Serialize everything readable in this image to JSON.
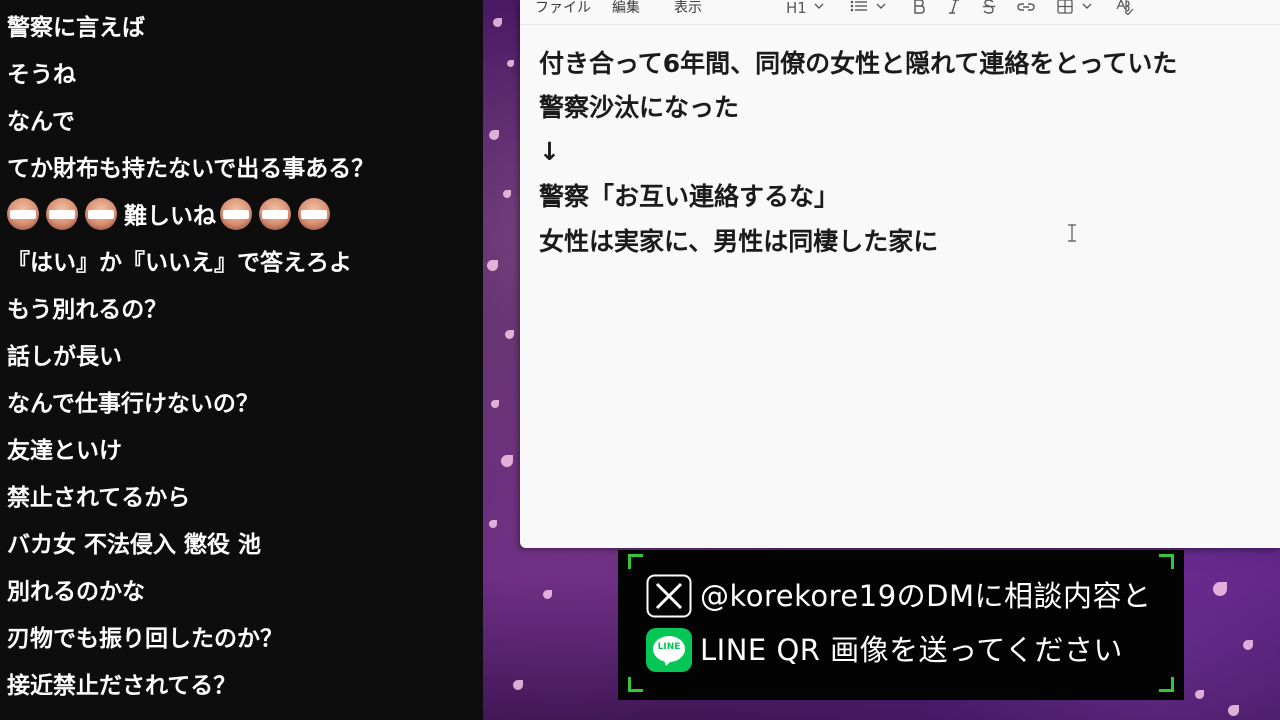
{
  "chat": {
    "messages": [
      "警察に言えば",
      "そうね",
      "なんで",
      "てか財布も持たないで出る事ある？",
      "難しいね",
      "『はい』か『いいえ』で答えろよ",
      "もう別れるの？",
      "話しが長い",
      "なんで仕事行けないの？",
      "友達といけ",
      "禁止されてるから",
      "バカ女 不法侵入 懲役 池",
      "別れるのかな",
      "刃物でも振り回したのか？",
      "接近禁止だされてる？"
    ]
  },
  "editor": {
    "menu": {
      "file": "ファイル",
      "edit": "編集",
      "view": "表示"
    },
    "toolbar": {
      "heading": "H1",
      "icons": [
        "heading-dropdown",
        "list-icon",
        "bold-icon",
        "italic-icon",
        "strikethrough-icon",
        "link-icon",
        "table-icon",
        "spellcheck-icon"
      ]
    },
    "lines": [
      "付き合って6年間、同僚の女性と隠れて連絡をとっていた",
      "警察沙汰になった",
      "↓",
      "警察「お互い連絡するな」",
      "女性は実家に、男性は同棲した家に"
    ]
  },
  "promo": {
    "line1": "@korekore19のDMに相談内容と",
    "line2": "LINE QR 画像を送ってください",
    "line_badge": "LINE",
    "accent_color": "#37c63a",
    "line_brand_color": "#06c755"
  }
}
